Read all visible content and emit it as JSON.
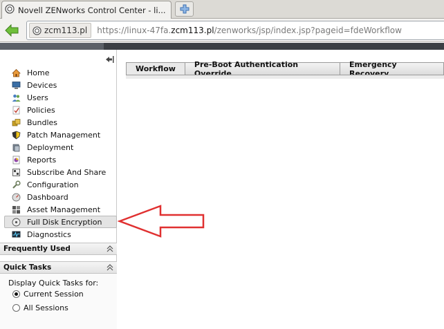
{
  "browser": {
    "tab_title": "Novell ZENworks Control Center - li...",
    "url_host_badge": "zcm113.pl",
    "url_prefix": "https://linux-47fa.",
    "url_domain": "zcm113.pl",
    "url_path": "/zenworks/jsp/index.jsp?pageid=fdeWorkflow"
  },
  "sidebar": {
    "items": [
      {
        "label": "Home",
        "icon": "home-icon",
        "color": "#d9822b"
      },
      {
        "label": "Devices",
        "icon": "monitor-icon",
        "color": "#3a6ea5"
      },
      {
        "label": "Users",
        "icon": "users-icon",
        "color": "#4a7fc1"
      },
      {
        "label": "Policies",
        "icon": "policy-icon",
        "color": "#c0392b"
      },
      {
        "label": "Bundles",
        "icon": "bundle-icon",
        "color": "#c9a227"
      },
      {
        "label": "Patch Management",
        "icon": "shield-icon",
        "color": "#d4a21a"
      },
      {
        "label": "Deployment",
        "icon": "deployment-icon",
        "color": "#5d6d7e"
      },
      {
        "label": "Reports",
        "icon": "reports-icon",
        "color": "#8e44ad"
      },
      {
        "label": "Subscribe And Share",
        "icon": "subscribe-icon",
        "color": "#555555"
      },
      {
        "label": "Configuration",
        "icon": "wrench-icon",
        "color": "#6f7f5f"
      },
      {
        "label": "Dashboard",
        "icon": "dashboard-icon",
        "color": "#777777"
      },
      {
        "label": "Asset Management",
        "icon": "asset-icon",
        "color": "#444444"
      },
      {
        "label": "Full Disk Encryption",
        "icon": "disk-encryption-icon",
        "color": "#666666",
        "selected": true
      },
      {
        "label": "Diagnostics",
        "icon": "diagnostics-icon",
        "color": "#2c3e50"
      }
    ],
    "frequently_used": "Frequently Used",
    "quick_tasks": "Quick Tasks",
    "quick_tasks_label": "Display Quick Tasks for:",
    "radio_current": "Current Session",
    "radio_all": "All Sessions"
  },
  "main": {
    "tabs": [
      "Workflow",
      "Pre-Boot Authentication Override",
      "Emergency Recovery"
    ]
  },
  "colors": {
    "arrow": "#e03030",
    "dark_strip": "#3b3f44"
  }
}
